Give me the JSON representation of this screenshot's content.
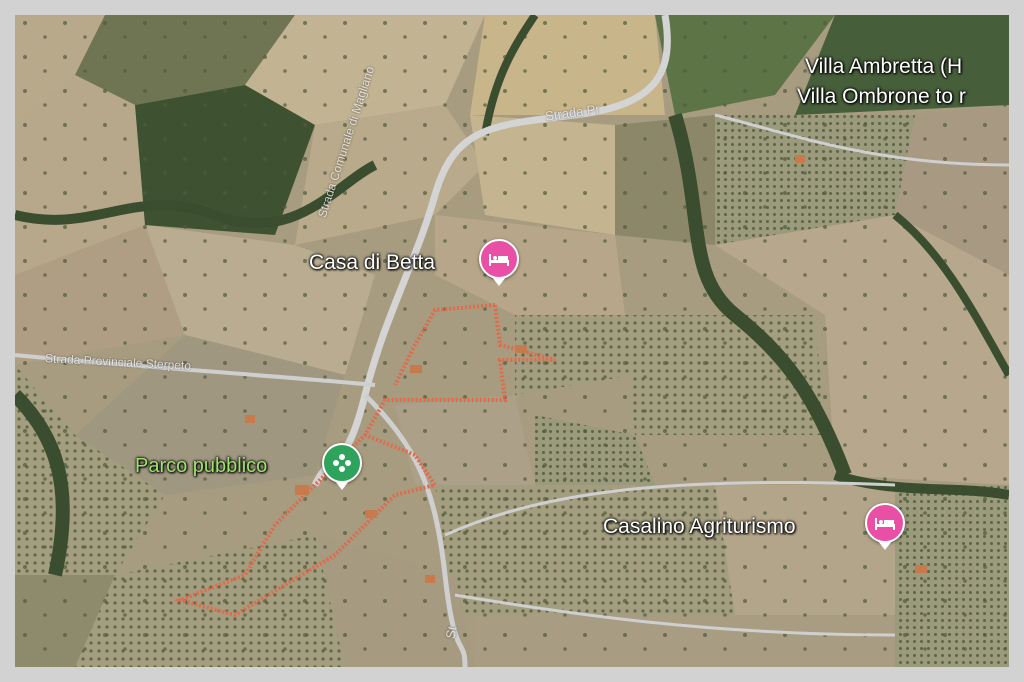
{
  "map": {
    "type": "satellite-view",
    "colors": {
      "field_light": "#c4b596",
      "field_dark": "#8a8a66",
      "forest": "#3e5232",
      "road": "#cfcfcf",
      "boundary": "#e2694a",
      "hotel_pin": "#ea4fa6",
      "park_pin": "#2ea35c",
      "park_label": "#9ee26c"
    },
    "places": [
      {
        "name": "Villa Ambretta (H",
        "category": "label"
      },
      {
        "name": "Villa Ombrone to r",
        "category": "label"
      },
      {
        "name": "Casa di Betta",
        "category": "hotel",
        "icon": "bed-icon"
      },
      {
        "name": "Parco pubblico",
        "category": "park",
        "icon": "flower-icon"
      },
      {
        "name": "Casalino Agriturismo",
        "category": "hotel",
        "icon": "bed-icon"
      }
    ],
    "roads": [
      {
        "name": "Strada Pr"
      },
      {
        "name": "Strada Comunale di Magliano"
      },
      {
        "name": "Strada Provinciale Sterpeto"
      },
      {
        "name": "St"
      }
    ]
  }
}
